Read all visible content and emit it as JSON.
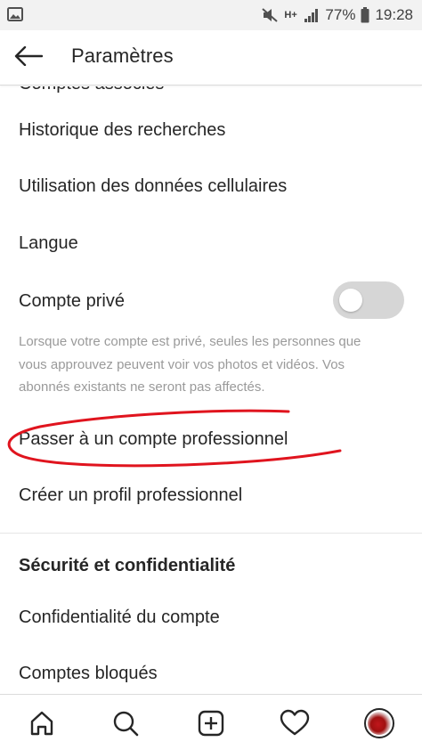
{
  "status_bar": {
    "network": "H+",
    "battery_percent": "77%",
    "time": "19:28",
    "icons": [
      "image-icon",
      "mute-icon",
      "network-icon",
      "signal-icon",
      "battery-icon"
    ]
  },
  "header": {
    "title": "Paramètres",
    "back_icon": "arrow-left-icon"
  },
  "settings": {
    "cut_off_item": "Comptes associés",
    "items": [
      "Historique des recherches",
      "Utilisation des données cellulaires",
      "Langue"
    ],
    "private_account": {
      "label": "Compte privé",
      "enabled": false,
      "helper": "Lorsque votre compte est privé, seules les personnes que vous approuvez peuvent voir vos photos et vidéos. Vos abonnés existants ne seront pas affectés."
    },
    "business_items": [
      "Passer à un compte professionnel",
      "Créer un profil professionnel"
    ],
    "section_title": "Sécurité et confidentialité",
    "security_items": [
      "Confidentialité du compte",
      "Comptes bloqués"
    ]
  },
  "annotation": {
    "color": "#e0141e",
    "shape": "hand-drawn ellipse around the business account option"
  },
  "bottom_nav": {
    "items": [
      "home-icon",
      "search-icon",
      "new-post-icon",
      "activity-heart-icon",
      "profile-avatar"
    ]
  }
}
